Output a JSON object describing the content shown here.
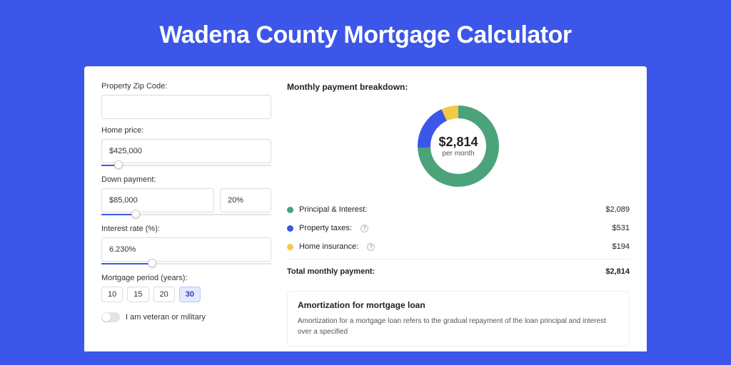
{
  "title": "Wadena County Mortgage Calculator",
  "left": {
    "zip_label": "Property Zip Code:",
    "zip_value": "",
    "home_price_label": "Home price:",
    "home_price_value": "$425,000",
    "home_price_slider_pct": 10,
    "down_payment_label": "Down payment:",
    "down_payment_value": "$85,000",
    "down_payment_pct": "20%",
    "down_payment_slider_pct": 20,
    "interest_label": "Interest rate (%):",
    "interest_value": "6.230%",
    "interest_slider_pct": 30,
    "period_label": "Mortgage period (years):",
    "periods": [
      "10",
      "15",
      "20",
      "30"
    ],
    "period_selected_index": 3,
    "veteran_label": "I am veteran or military",
    "veteran_on": false
  },
  "right": {
    "breakdown_title": "Monthly payment breakdown:",
    "donut_amount": "$2,814",
    "donut_sub": "per month",
    "items": [
      {
        "label": "Principal & Interest:",
        "value": "$2,089",
        "color": "#4aa37a",
        "help": false
      },
      {
        "label": "Property taxes:",
        "value": "$531",
        "color": "#3b56e8",
        "help": true
      },
      {
        "label": "Home insurance:",
        "value": "$194",
        "color": "#f3c948",
        "help": true
      }
    ],
    "total_label": "Total monthly payment:",
    "total_value": "$2,814",
    "amort_title": "Amortization for mortgage loan",
    "amort_text": "Amortization for a mortgage loan refers to the gradual repayment of the loan principal and interest over a specified"
  },
  "chart_data": {
    "type": "pie",
    "title": "Monthly payment breakdown",
    "series": [
      {
        "name": "Principal & Interest",
        "value": 2089,
        "color": "#4aa37a"
      },
      {
        "name": "Property taxes",
        "value": 531,
        "color": "#3b56e8"
      },
      {
        "name": "Home insurance",
        "value": 194,
        "color": "#f3c948"
      }
    ],
    "total": 2814,
    "center_label": "$2,814 per month"
  }
}
